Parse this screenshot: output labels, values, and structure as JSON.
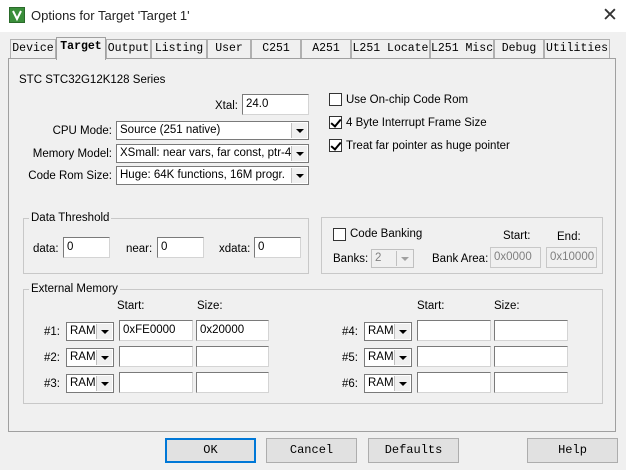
{
  "window": {
    "title": "Options for Target 'Target 1'"
  },
  "tabs": [
    "Device",
    "Target",
    "Output",
    "Listing",
    "User",
    "C251",
    "A251",
    "L251 Locate",
    "L251 Misc",
    "Debug",
    "Utilities"
  ],
  "active_tab": "Target",
  "series_label": "STC STC32G12K128 Series",
  "xtal": {
    "label": "Xtal:",
    "value": "24.0"
  },
  "cpu_mode": {
    "label": "CPU Mode:",
    "value": "Source (251 native)"
  },
  "memory_model": {
    "label": "Memory Model:",
    "value": "XSmall: near vars, far const, ptr-4"
  },
  "code_rom_size": {
    "label": "Code Rom Size:",
    "value": "Huge: 64K functions, 16M progr."
  },
  "checkboxes": {
    "onchip_rom": {
      "label": "Use On-chip Code Rom",
      "checked": false
    },
    "interrupt_frame": {
      "label": "4 Byte Interrupt Frame Size",
      "checked": true
    },
    "far_pointer": {
      "label": "Treat far pointer as huge pointer",
      "checked": true
    }
  },
  "data_threshold": {
    "title": "Data Threshold",
    "data_label": "data:",
    "data_value": "0",
    "near_label": "near:",
    "near_value": "0",
    "xdata_label": "xdata:",
    "xdata_value": "0"
  },
  "code_banking": {
    "label": "Code Banking",
    "checked": false,
    "banks_label": "Banks:",
    "banks_value": "2",
    "bank_area_label": "Bank Area:",
    "start_label": "Start:",
    "end_label": "End:",
    "start_value": "0x0000",
    "end_value": "0x10000"
  },
  "external_memory": {
    "title": "External Memory",
    "start_label": "Start:",
    "size_label": "Size:",
    "rows": [
      {
        "label": "#1:",
        "type": "RAM",
        "start": "0xFE0000",
        "size": "0x20000"
      },
      {
        "label": "#2:",
        "type": "RAM",
        "start": "",
        "size": ""
      },
      {
        "label": "#3:",
        "type": "RAM",
        "start": "",
        "size": ""
      },
      {
        "label": "#4:",
        "type": "RAM",
        "start": "",
        "size": ""
      },
      {
        "label": "#5:",
        "type": "RAM",
        "start": "",
        "size": ""
      },
      {
        "label": "#6:",
        "type": "RAM",
        "start": "",
        "size": ""
      }
    ]
  },
  "buttons": {
    "ok": "OK",
    "cancel": "Cancel",
    "defaults": "Defaults",
    "help": "Help"
  }
}
